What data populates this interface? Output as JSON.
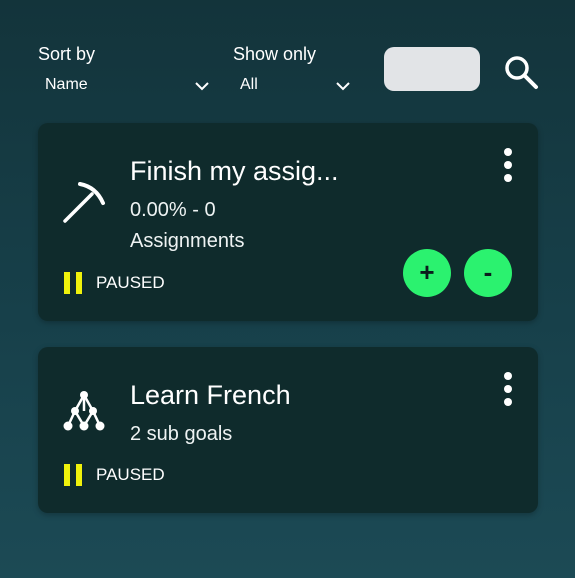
{
  "filters": {
    "sort_label": "Sort by",
    "sort_value": "Name",
    "show_label": "Show only",
    "show_value": "All"
  },
  "icons": {
    "search": "search-icon",
    "card1": "pickaxe-icon",
    "card2": "tree-hierarchy-icon",
    "menu": "more-vertical-icon",
    "pause": "pause-icon",
    "dropdown": "chevron-down-icon"
  },
  "colors": {
    "background": "#17404a",
    "card": "#0f2b2c",
    "accent_green": "#2bf26f",
    "paused_yellow": "#f0f20c",
    "search_box": "#e2e4e7"
  },
  "goals": [
    {
      "title": "Finish my assig...",
      "progress": "0.00% - 0",
      "subtitle": "Assignments",
      "status": "PAUSED",
      "plus_label": "+",
      "minus_label": "-"
    },
    {
      "title": "Learn French",
      "subtitle": "2 sub goals",
      "status": "PAUSED"
    }
  ]
}
